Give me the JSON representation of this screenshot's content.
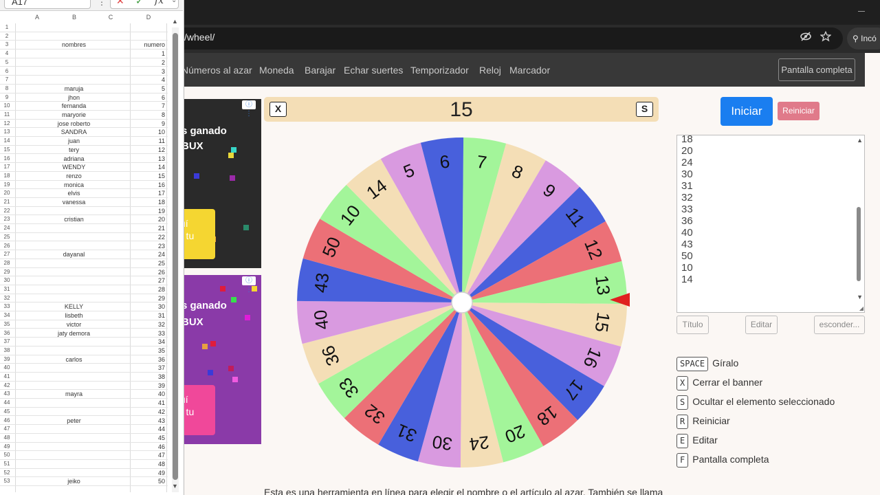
{
  "browser": {
    "url": "/wheel/",
    "incognito_label": "Incó"
  },
  "nav": {
    "items": [
      "Números al azar",
      "Moneda",
      "Barajar",
      "Echar suertes",
      "Temporizador",
      "Reloj",
      "Marcador"
    ],
    "fullscreen_label": "Pantalla completa"
  },
  "ads": {
    "title_line1": "s ganado",
    "title_line2": "BUX",
    "button_line1": "uí",
    "button_line2": "r tu",
    "info_label": "ⓘ ⋮"
  },
  "banner": {
    "close_key": "X",
    "selected_value": "15",
    "hide_key": "S"
  },
  "wheel": {
    "segments": [
      "7",
      "8",
      "9",
      "11",
      "12",
      "13",
      "15",
      "16",
      "17",
      "18",
      "20",
      "24",
      "30",
      "31",
      "32",
      "33",
      "36",
      "40",
      "43",
      "50",
      "10",
      "14",
      "5",
      "6"
    ],
    "colors": {
      "green": "#a3f59a",
      "cream": "#f4deb6",
      "violet": "#d99ae0",
      "blue": "#4860dc",
      "red": "#ec7077"
    },
    "pointer_color": "#e02020"
  },
  "controls": {
    "start_label": "Iniciar",
    "reset_label": "Reiniciar",
    "entries": [
      "18",
      "20",
      "24",
      "30",
      "31",
      "32",
      "33",
      "36",
      "40",
      "43",
      "50",
      "10",
      "14"
    ],
    "title_button": "Título",
    "edit_button": "Editar",
    "hide_button": "esconder..."
  },
  "shortcuts": [
    {
      "key": "SPACE",
      "label": "Gíralo"
    },
    {
      "key": "X",
      "label": "Cerrar el banner"
    },
    {
      "key": "S",
      "label": "Ocultar el elemento seleccionado"
    },
    {
      "key": "R",
      "label": "Reiniciar"
    },
    {
      "key": "E",
      "label": "Editar"
    },
    {
      "key": "F",
      "label": "Pantalla completa"
    }
  ],
  "description": "Esta es una herramienta en línea para elegir el nombre o el artículo al azar. También se llama",
  "spreadsheet": {
    "name_box": "A17",
    "columns": [
      "A",
      "B",
      "C",
      "D"
    ],
    "rows": [
      {
        "n": "1",
        "b": "",
        "d": ""
      },
      {
        "n": "2",
        "b": "",
        "d": ""
      },
      {
        "n": "3",
        "b": "nombres",
        "d": "numero"
      },
      {
        "n": "4",
        "b": "",
        "d": "1"
      },
      {
        "n": "5",
        "b": "",
        "d": "2"
      },
      {
        "n": "6",
        "b": "",
        "d": "3"
      },
      {
        "n": "7",
        "b": "",
        "d": "4"
      },
      {
        "n": "8",
        "b": "maruja",
        "d": "5"
      },
      {
        "n": "9",
        "b": "jhon",
        "d": "6"
      },
      {
        "n": "10",
        "b": "fernanda",
        "d": "7"
      },
      {
        "n": "11",
        "b": "maryorie",
        "d": "8"
      },
      {
        "n": "12",
        "b": "jose roberto",
        "d": "9"
      },
      {
        "n": "13",
        "b": "SANDRA",
        "d": "10"
      },
      {
        "n": "14",
        "b": "juan",
        "d": "11"
      },
      {
        "n": "15",
        "b": "tery",
        "d": "12"
      },
      {
        "n": "16",
        "b": "adriana",
        "d": "13"
      },
      {
        "n": "17",
        "b": "WENDY",
        "d": "14"
      },
      {
        "n": "18",
        "b": "renzo",
        "d": "15"
      },
      {
        "n": "19",
        "b": "monica",
        "d": "16"
      },
      {
        "n": "20",
        "b": "elvis",
        "d": "17"
      },
      {
        "n": "21",
        "b": "vanessa",
        "d": "18"
      },
      {
        "n": "22",
        "b": "",
        "d": "19"
      },
      {
        "n": "23",
        "b": "cristian",
        "d": "20"
      },
      {
        "n": "24",
        "b": "",
        "d": "21"
      },
      {
        "n": "25",
        "b": "",
        "d": "22"
      },
      {
        "n": "26",
        "b": "",
        "d": "23"
      },
      {
        "n": "27",
        "b": "dayanal",
        "d": "24"
      },
      {
        "n": "28",
        "b": "",
        "d": "25"
      },
      {
        "n": "29",
        "b": "",
        "d": "26"
      },
      {
        "n": "30",
        "b": "",
        "d": "27"
      },
      {
        "n": "31",
        "b": "",
        "d": "28"
      },
      {
        "n": "32",
        "b": "",
        "d": "29"
      },
      {
        "n": "33",
        "b": "KELLY",
        "d": "30"
      },
      {
        "n": "34",
        "b": "lisbeth",
        "d": "31"
      },
      {
        "n": "35",
        "b": "victor",
        "d": "32"
      },
      {
        "n": "36",
        "b": "jaty demora",
        "d": "33"
      },
      {
        "n": "37",
        "b": "",
        "d": "34"
      },
      {
        "n": "38",
        "b": "",
        "d": "35"
      },
      {
        "n": "39",
        "b": "carlos",
        "d": "36"
      },
      {
        "n": "40",
        "b": "",
        "d": "37"
      },
      {
        "n": "41",
        "b": "",
        "d": "38"
      },
      {
        "n": "42",
        "b": "",
        "d": "39"
      },
      {
        "n": "43",
        "b": "mayra",
        "d": "40"
      },
      {
        "n": "44",
        "b": "",
        "d": "41"
      },
      {
        "n": "45",
        "b": "",
        "d": "42"
      },
      {
        "n": "46",
        "b": "peter",
        "d": "43"
      },
      {
        "n": "47",
        "b": "",
        "d": "44"
      },
      {
        "n": "48",
        "b": "",
        "d": "45"
      },
      {
        "n": "49",
        "b": "",
        "d": "46"
      },
      {
        "n": "50",
        "b": "",
        "d": "47"
      },
      {
        "n": "51",
        "b": "",
        "d": "48"
      },
      {
        "n": "52",
        "b": "",
        "d": "49"
      },
      {
        "n": "53",
        "b": "jeiko",
        "d": "50"
      }
    ]
  }
}
